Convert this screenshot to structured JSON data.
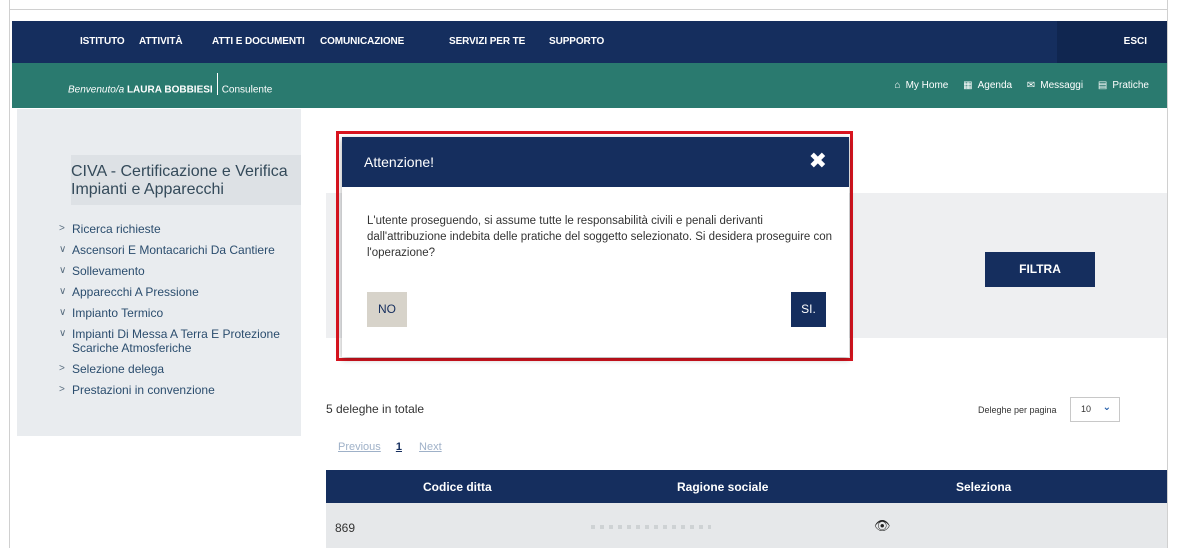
{
  "topnav": {
    "items": [
      "ISTITUTO",
      "ATTIVITÀ",
      "ATTI E DOCUMENTI",
      "COMUNICAZIONE",
      "SERVIZI PER TE",
      "SUPPORTO"
    ],
    "logout": "ESCI"
  },
  "subnav": {
    "welcome_prefix": "Benvenuto/a",
    "user_name": "LAURA BOBBIESI",
    "role": "Consulente",
    "links": [
      {
        "icon": "home-icon",
        "glyph": "⌂",
        "label": "My Home"
      },
      {
        "icon": "calendar-icon",
        "glyph": "▦",
        "label": "Agenda"
      },
      {
        "icon": "envelope-icon",
        "glyph": "✉",
        "label": "Messaggi"
      },
      {
        "icon": "archive-icon",
        "glyph": "▤",
        "label": "Pratiche"
      }
    ]
  },
  "sidebar": {
    "title": "CIVA - Certificazione e Verifica Impianti e Apparecchi",
    "items": [
      {
        "label": "Ricerca richieste",
        "chevron": ">"
      },
      {
        "label": "Ascensori E Montacarichi Da Cantiere",
        "chevron": "∨"
      },
      {
        "label": "Sollevamento",
        "chevron": "∨"
      },
      {
        "label": "Apparecchi A Pressione",
        "chevron": "∨"
      },
      {
        "label": "Impianto Termico",
        "chevron": "∨"
      },
      {
        "label": "Impianti Di Messa A Terra E Protezione Scariche Atmosferiche",
        "chevron": "∨"
      },
      {
        "label": "Selezione delega",
        "chevron": ">"
      },
      {
        "label": "Prestazioni in convenzione",
        "chevron": ">"
      }
    ]
  },
  "filter": {
    "button_label": "FILTRA"
  },
  "results": {
    "total_text": "5 deleghe in totale",
    "per_page_label": "Deleghe per pagina",
    "per_page_value": "10"
  },
  "pager": {
    "previous": "Previous",
    "current": "1",
    "next": "Next"
  },
  "table": {
    "columns": [
      "Codice ditta",
      "Ragione sociale",
      "Seleziona"
    ],
    "rows": [
      {
        "codice": "869",
        "ragione": "",
        "seleziona": "👁"
      }
    ]
  },
  "modal": {
    "title": "Attenzione!",
    "close": "✖",
    "message": "L'utente proseguendo, si assume tutte le responsabilità civili e penali derivanti dall'attribuzione indebita delle pratiche del soggetto selezionato. Si desidera proseguire con l'operazione?",
    "no_label": "NO",
    "yes_label": "SI."
  },
  "colors": {
    "navy": "#152e5e",
    "teal": "#2a7a6f",
    "highlight_red": "#d9141f"
  }
}
